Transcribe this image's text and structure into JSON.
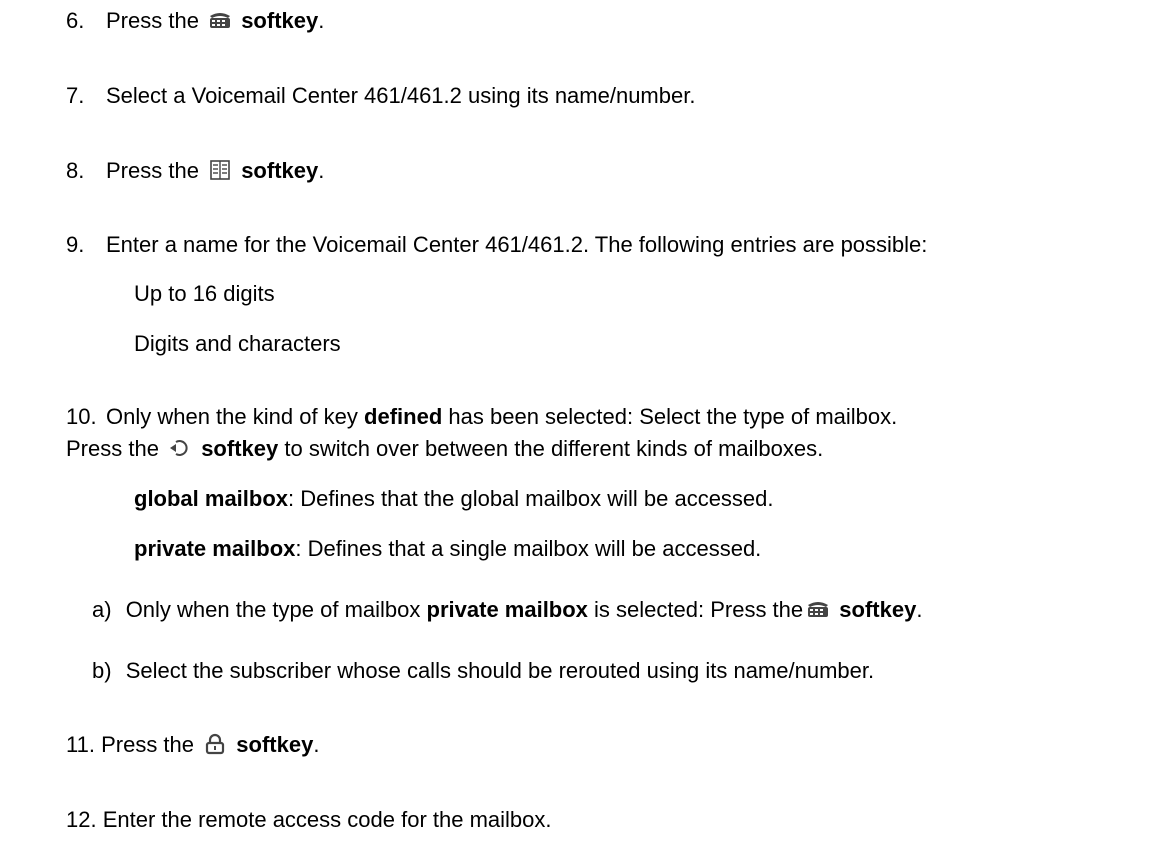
{
  "steps": [
    {
      "num": "6.",
      "pre": "Press the",
      "icon": "dial-pad-icon",
      "key": "softkey",
      "post": "."
    },
    {
      "num": "7.",
      "text": "Select a Voicemail Center 461/461.2 using its name/number."
    },
    {
      "num": "8.",
      "pre": "Press the",
      "icon": "phonebook-icon",
      "key": "softkey",
      "post": "."
    },
    {
      "num": "9.",
      "text": "Enter a name for the Voicemail Center 461/461.2. The following entries are possible:",
      "options": [
        "Up to 16 digits",
        "Digits and characters"
      ]
    },
    {
      "num": "10.",
      "line1_pre": "Only when the kind of key",
      "line1_bold": "defined",
      "line1_post": "has been selected: Select the type of mailbox.",
      "line2_pre": "Press the",
      "line2_icon": "toggle-icon",
      "line2_key": "softkey",
      "line2_post": "to switch over between the different kinds of mailboxes.",
      "options": [
        {
          "term": "global mailbox",
          "desc": ": Defines that the global mailbox will be accessed."
        },
        {
          "term": "private mailbox",
          "desc": ": Defines that a single mailbox will be accessed."
        }
      ],
      "substeps": [
        {
          "label": "a)",
          "pre": "Only when the type of mailbox",
          "bold": "private mailbox",
          "mid": "is selected: Press the",
          "icon": "dial-pad-icon",
          "key": "softkey",
          "post": "."
        },
        {
          "label": "b)",
          "text": "Select the subscriber whose calls should be rerouted using its name/number."
        }
      ]
    },
    {
      "num": "11.",
      "pre": "Press the",
      "icon": "lock-icon",
      "key": "softkey",
      "post": "."
    },
    {
      "num": "12.",
      "text": "Enter the remote access code for the mailbox."
    }
  ]
}
